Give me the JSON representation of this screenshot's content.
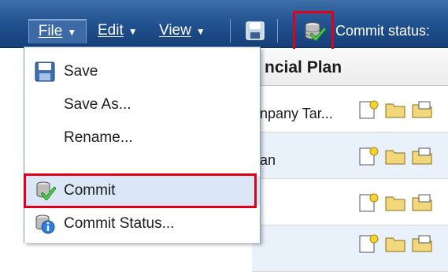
{
  "toolbar": {
    "menus": [
      {
        "label": "File"
      },
      {
        "label": "Edit"
      },
      {
        "label": "View"
      }
    ],
    "commit_status_label": "Commit status:"
  },
  "panel": {
    "title": "ncial Plan",
    "rows": [
      {
        "text": "npany Tar..."
      },
      {
        "text": "an"
      },
      {
        "text": ""
      },
      {
        "text": ""
      }
    ]
  },
  "file_menu": {
    "items": [
      {
        "label": "Save",
        "icon": "save-icon"
      },
      {
        "label": "Save As...",
        "icon": ""
      },
      {
        "label": "Rename...",
        "icon": ""
      },
      {
        "label": "Commit",
        "icon": "commit-icon"
      },
      {
        "label": "Commit Status...",
        "icon": "commit-status-icon"
      }
    ]
  },
  "colors": {
    "toolbar_blue": "#1f4f8c",
    "highlight_red": "#e0001a",
    "menu_hover": "#dbe7f6",
    "row_alt": "#e9f1fb"
  }
}
